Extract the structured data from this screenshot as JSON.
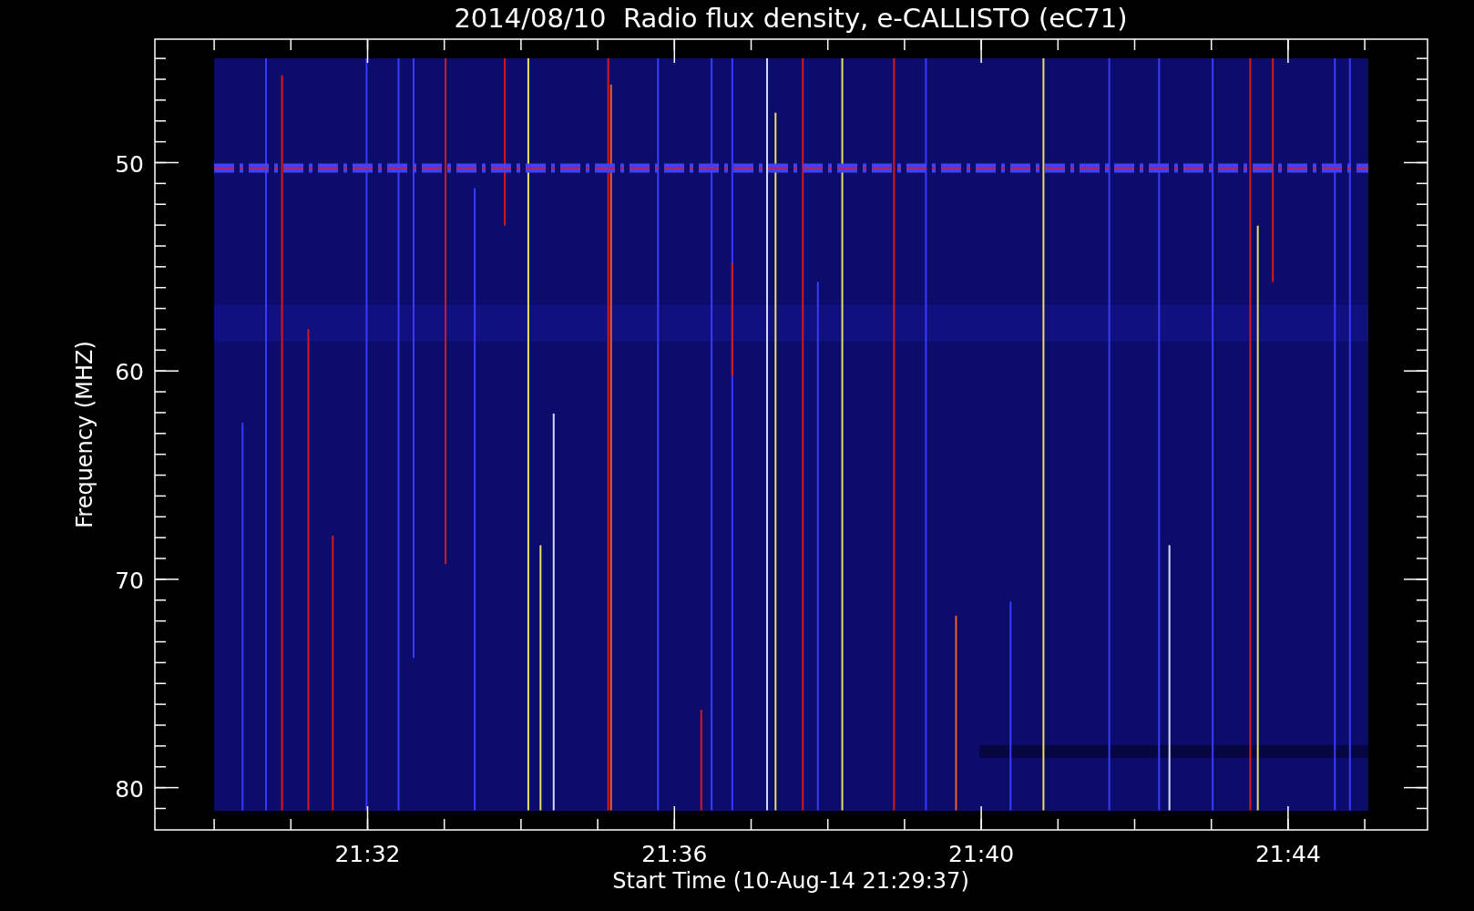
{
  "title": "2014/08/10  Radio flux density, e-CALLISTO (eC71)",
  "y_axis": {
    "label": "Frequency (MHZ)",
    "ticks": [
      "50",
      "60",
      "70",
      "80"
    ]
  },
  "x_axis": {
    "label": "Start Time (10-Aug-14 21:29:37)",
    "ticks": [
      "21:32",
      "21:36",
      "21:40",
      "21:44"
    ]
  }
}
